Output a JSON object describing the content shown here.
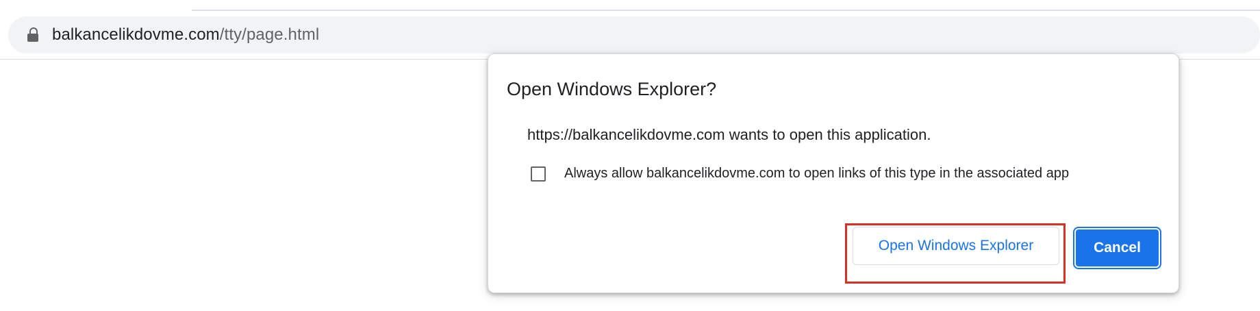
{
  "browser": {
    "address_bar": {
      "domain": "balkancelikdovme.com",
      "path": "/tty/page.html"
    }
  },
  "dialog": {
    "title": "Open Windows Explorer?",
    "message": "https://balkancelikdovme.com wants to open this application.",
    "checkbox": {
      "label": "Always allow balkancelikdovme.com to open links of this type in the associated app",
      "checked": false
    },
    "buttons": {
      "open_label": "Open Windows Explorer",
      "cancel_label": "Cancel"
    }
  },
  "colors": {
    "accent": "#1a73e8",
    "highlight": "#d93025",
    "text": "#202124",
    "muted": "#5f6368"
  },
  "icons": {
    "address_bar": "lock-icon",
    "checkbox": "checkbox-unchecked"
  }
}
